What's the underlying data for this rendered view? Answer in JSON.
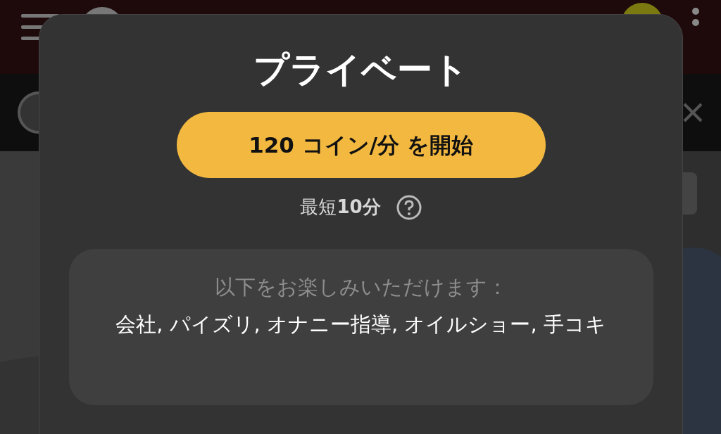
{
  "dialog": {
    "title": "プライベート",
    "start_button": "120 コイン/分 を開始",
    "minimum": "最短**10分**",
    "features": {
      "heading": "以下をお楽しみいただけます：",
      "text": "会社, パイズリ, オナニー指導, オイルショー, 手コキ"
    }
  }
}
